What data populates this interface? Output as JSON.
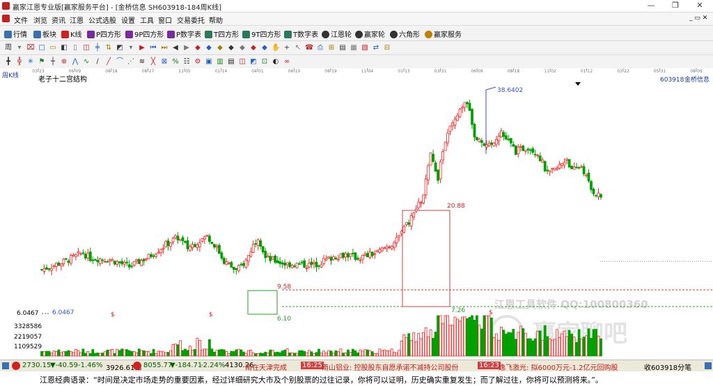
{
  "window": {
    "title": "赢家江恩专业版[赢家服务平台] - [金桥信息  SH603918-184周K线]",
    "minimize": "—",
    "restore": "❐",
    "close": "✕"
  },
  "menu": [
    "文件",
    "浏览",
    "资讯",
    "江恩",
    "公式选股",
    "设置",
    "工具",
    "窗口",
    "交易委托",
    "帮助"
  ],
  "toolbar": [
    {
      "label": "行情",
      "icon": "grid-icon",
      "color": "#3a6fb0"
    },
    {
      "label": "板块",
      "icon": "blocks-icon",
      "color": "#3a6fb0"
    },
    {
      "label": "K线",
      "icon": "candle-icon",
      "color": "#d02020"
    },
    {
      "label": "P四方形",
      "icon": "p-square-icon",
      "color": "#7a2a9a"
    },
    {
      "label": "9P四方形",
      "icon": "9p-square-icon",
      "color": "#7a2a9a"
    },
    {
      "label": "P数字表",
      "icon": "p-table-icon",
      "color": "#7a2a9a"
    },
    {
      "label": "T四方形",
      "icon": "t-square-icon",
      "color": "#2a7a5a"
    },
    {
      "label": "9T四方形",
      "icon": "9t-square-icon",
      "color": "#2a7a5a"
    },
    {
      "label": "T数字表",
      "icon": "t-table-icon",
      "color": "#2a7a5a"
    },
    {
      "label": "江恩轮",
      "icon": "wheel-icon",
      "color": "#333333"
    },
    {
      "label": "赢家轮",
      "icon": "winner-wheel-icon",
      "color": "#333333"
    },
    {
      "label": "六角形",
      "icon": "hexagon-icon",
      "color": "#333333"
    },
    {
      "label": "赢家服务",
      "icon": "dollar-icon",
      "color": "#c08000"
    }
  ],
  "drawing_toolbar_glyphs": [
    "周",
    "▾",
    "⌧",
    "□",
    "▭",
    "◧",
    "▯",
    "◫",
    "╪",
    "⇅",
    "◩",
    "▾",
    "▶",
    "⏮",
    "⏭",
    "◀",
    "▶",
    "◆",
    "◆",
    "◆",
    "◆",
    "◆",
    "◆",
    "◆",
    "✋",
    "+",
    "↖",
    "☎",
    "⎙",
    "⊞",
    "▤",
    "▦",
    "▧",
    "⇄",
    "⊟"
  ],
  "indicator_toolbar_glyphs": [
    "╋",
    "╬",
    "✳",
    "⚑",
    "┼",
    "⊕",
    "⋀",
    "∿",
    "∕",
    "╱",
    "⌒",
    "⋰",
    "≋",
    "╳",
    "⊠",
    "%",
    "☷",
    "⚙",
    "▣",
    "▥",
    "▤",
    "◫",
    "◩",
    "⊡",
    "◐",
    "∞"
  ],
  "chart_data": {
    "type": "candlestick",
    "period_label": "周K线",
    "indicator_title": "老子十二宫结构",
    "stock_code": "603918",
    "stock_name": "金桥信息",
    "x_tick_labels": [
      "03-23",
      "06-09",
      "08-18",
      "08-27",
      "11-05",
      "01-14",
      "04-01",
      "06-10",
      "08-19",
      "11-04",
      "01-13",
      "03-31",
      "06-09",
      "08-18",
      "11-02",
      "01-12",
      "03-22",
      "05-31",
      "08-09"
    ],
    "left_price_label": "6.0467",
    "low_label": "6.0467",
    "high_label": "38.6402",
    "box1": {
      "high": "9.58",
      "low": "6.10"
    },
    "box2": {
      "high": "20.88",
      "low": "7.26"
    },
    "dollar_marker": "$",
    "volume_labels": [
      "3328586",
      "2219057",
      "1109529"
    ],
    "watermark_line": "江恩工具软件  QQ:100800360",
    "watermark_logo": "赢家聊吧",
    "price_range": [
      4,
      42
    ],
    "candle_colors": {
      "up": "#ff2020",
      "down": "#00a000"
    }
  },
  "status": {
    "sh_index": "2730.15",
    "sh_change": "▼-40.59",
    "sh_pct": "-1.46%",
    "sh_amount": "3926.61亿",
    "sz_index": "8055.77",
    "sz_change": "▼-184.71",
    "sz_pct": "-2.24%",
    "sz_amount": "4130.26",
    "news1": "南在天津完成",
    "news_time1": "16:25",
    "news2": "南山铝业: 控股股东自愿承诺不减持公司股份",
    "news_time2": "16:23",
    "news3": "逸飞激光: 拟6000万元-1.2亿元回购股",
    "right_info": "收603918分笔"
  },
  "quote": "江恩经典语录：“时间是决定市场走势的重要因素，经过详细研究大市及个别股票的过往记录，你将可以证明，历史确实重复发生；而了解过往，你将可以预测将来。”。"
}
